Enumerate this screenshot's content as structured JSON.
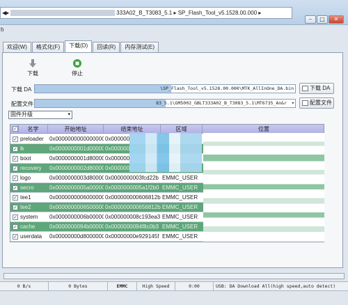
{
  "window": {
    "address_segments": [
      "333A02_B_T3083_5.1",
      "SP_Flash_Tool_v5.1528.00.000"
    ],
    "menu_hint": "ḥ"
  },
  "tabs": [
    {
      "label": "欢迎(W)"
    },
    {
      "label": "格式化(F)"
    },
    {
      "label": "下载(D)"
    },
    {
      "label": "回读(R)"
    },
    {
      "label": "内存测试(E)"
    }
  ],
  "toolbar": {
    "download_label": "下载",
    "stop_label": "停止"
  },
  "download_agent": {
    "label": "下载 DA",
    "value": "\\SP_Flash_Tool_v5.1528.00.000\\MTK_AllInOne_DA.bin",
    "button": "下载 DA"
  },
  "scatter": {
    "label": "配置文件",
    "value": "83_5.1\\GM5002_GBLT333A02_B_T3083_5.1\\MT6735_An&r",
    "button": "配置文件"
  },
  "mode": {
    "value": "固件升级"
  },
  "table": {
    "columns": [
      "名字",
      "开始地址",
      "结束地址",
      "区域",
      "位置"
    ],
    "rows": [
      {
        "name": "preloader",
        "start": "0x0000000000000000",
        "end": "0x000000",
        "region": "",
        "location": "",
        "green": false
      },
      {
        "name": "lk",
        "start": "0x0000000001d00000",
        "end": "0x000000",
        "region": "",
        "location": "",
        "green": true
      },
      {
        "name": "boot",
        "start": "0x0000000001d80000",
        "end": "0x000000",
        "region": "",
        "location": "",
        "green": false
      },
      {
        "name": "recovery",
        "start": "0x0000000002d80000",
        "end": "0x000000",
        "region": "",
        "location": "",
        "green": true
      },
      {
        "name": "logo",
        "start": "0x0000000003d80000",
        "end": "0x0000000003fcd22b",
        "region": "EMMC_USER",
        "location": "",
        "green": false
      },
      {
        "name": "secro",
        "start": "0x0000000005a00000",
        "end": "0x0000000005a1f2b0",
        "region": "EMMC_USER",
        "location": "",
        "green": true
      },
      {
        "name": "tee1",
        "start": "0x0000000006000000",
        "end": "0x000000000606812b",
        "region": "EMMC_USER",
        "location": "",
        "green": false
      },
      {
        "name": "tee2",
        "start": "0x0000000006500000",
        "end": "0x000000000656812b",
        "region": "EMMC_USER",
        "location": "",
        "green": true
      },
      {
        "name": "system",
        "start": "0x0000000006b00000",
        "end": "0x000000008c193ea3",
        "region": "EMMC_USER",
        "location": "",
        "green": false
      },
      {
        "name": "cache",
        "start": "0x0000000094b00000",
        "end": "0x0000000094f8c0b3",
        "region": "EMMC_USER",
        "location": "",
        "green": true
      },
      {
        "name": "userdata",
        "start": "0x00000000d8000000",
        "end": "0x00000000e929145f",
        "region": "EMMC_USER",
        "location": "",
        "green": false
      }
    ]
  },
  "status": {
    "speed": "0 B/s",
    "bytes": "0 Bytes",
    "storage": "EMMC",
    "mode": "High Speed",
    "time": "0:00",
    "info": "USB: DA Download All(high speed,auto detect)",
    "progress": 0
  },
  "colors": {
    "green_row": "#5fa67a",
    "header": "#b3b3e6"
  }
}
